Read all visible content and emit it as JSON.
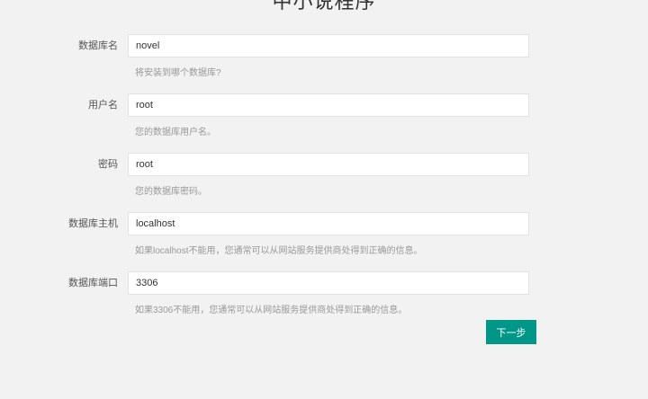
{
  "header": {
    "title": "中小说程序"
  },
  "form": {
    "fields": [
      {
        "label": "数据库名",
        "value": "novel",
        "help": "将安装到哪个数据库?"
      },
      {
        "label": "用户名",
        "value": "root",
        "help": "您的数据库用户名。"
      },
      {
        "label": "密码",
        "value": "root",
        "help": "您的数据库密码。"
      },
      {
        "label": "数据库主机",
        "value": "localhost",
        "help": "如果localhost不能用，您通常可以从网站服务提供商处得到正确的信息。"
      },
      {
        "label": "数据库端口",
        "value": "3306",
        "help": "如果3306不能用，您通常可以从网站服务提供商处得到正确的信息。"
      }
    ],
    "next_label": "下一步"
  },
  "colors": {
    "accent": "#009688",
    "background": "#f2f2f2"
  }
}
